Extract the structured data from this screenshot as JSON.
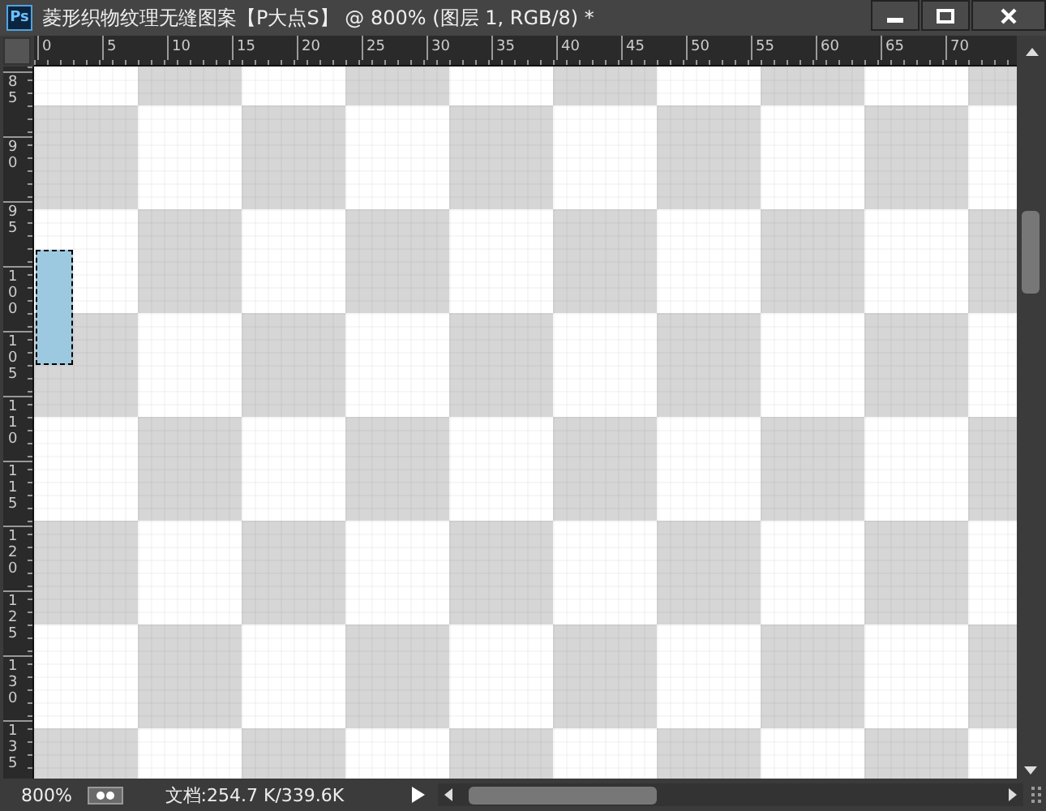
{
  "window": {
    "app_badge": "Ps",
    "title": "菱形织物纹理无缝图案【P大点S】 @ 800% (图层 1, RGB/8) *"
  },
  "ruler_top": {
    "labels": [
      "0",
      "5",
      "10",
      "15",
      "20",
      "25",
      "30",
      "35",
      "40",
      "45",
      "50",
      "55",
      "60",
      "65",
      "70"
    ]
  },
  "ruler_left": {
    "labels": [
      "85",
      "90",
      "95",
      "100",
      "105",
      "110",
      "115",
      "120",
      "125",
      "130",
      "135"
    ]
  },
  "status_bar": {
    "zoom": "800%",
    "document": "文档:254.7 K/339.6K"
  }
}
